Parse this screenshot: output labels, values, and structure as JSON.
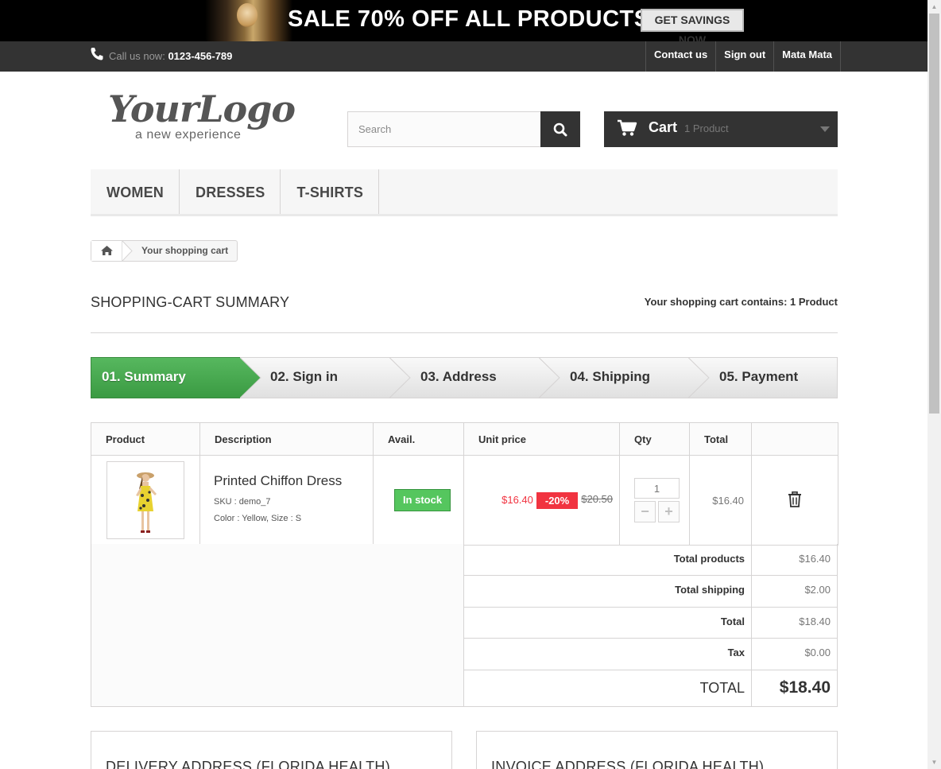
{
  "promo": {
    "text": "SALE 70% OFF ALL PRODUCTS",
    "button": "GET SAVINGS NOW"
  },
  "topnav": {
    "call_label": "Call us now:",
    "phone": "0123-456-789",
    "links": [
      "Contact us",
      "Sign out",
      "Mata Mata"
    ]
  },
  "header": {
    "logo_main": "YourLogo",
    "logo_sub": "a new experience",
    "search_placeholder": "Search",
    "cart_label": "Cart",
    "cart_count": "1 Product"
  },
  "menu": [
    "WOMEN",
    "DRESSES",
    "T-SHIRTS"
  ],
  "breadcrumb": {
    "current": "Your shopping cart"
  },
  "page": {
    "title": "SHOPPING-CART SUMMARY",
    "contains_label": "Your shopping cart contains:",
    "contains_value": "1 Product"
  },
  "steps": [
    "01. Summary",
    "02. Sign in",
    "03. Address",
    "04. Shipping",
    "05. Payment"
  ],
  "table": {
    "headers": [
      "Product",
      "Description",
      "Avail.",
      "Unit price",
      "Qty",
      "Total"
    ],
    "item": {
      "name": "Printed Chiffon Dress",
      "sku": "SKU : demo_7",
      "attrs": "Color : Yellow, Size : S",
      "availability": "In stock",
      "price": "$16.40",
      "discount": "-20%",
      "old_price": "$20.50",
      "qty": "1",
      "total": "$16.40"
    }
  },
  "summary": {
    "total_products_label": "Total products",
    "total_products": "$16.40",
    "total_shipping_label": "Total shipping",
    "total_shipping": "$2.00",
    "total_label": "Total",
    "total": "$18.40",
    "tax_label": "Tax",
    "tax": "$0.00",
    "grand_label": "TOTAL",
    "grand": "$18.40"
  },
  "addresses": {
    "delivery": "DELIVERY ADDRESS (FLORIDA HEALTH)",
    "invoice": "INVOICE ADDRESS (FLORIDA HEALTH)"
  },
  "colors": {
    "active_step": "#46a74e",
    "price_red": "#f13340",
    "stock_green": "#55c65e",
    "dark_bar": "#333333"
  },
  "icons": [
    "phone-icon",
    "search-icon",
    "cart-icon",
    "chevron-down-icon",
    "home-icon",
    "trash-icon"
  ]
}
